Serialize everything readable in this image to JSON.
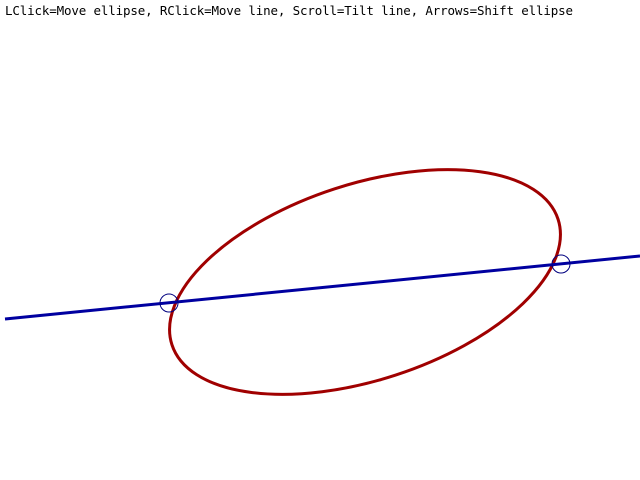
{
  "instructions": "LClick=Move ellipse, RClick=Move line, Scroll=Tilt line, Arrows=Shift ellipse",
  "colors": {
    "background": "#ffffff",
    "text": "#000000",
    "ellipse": "#a00000",
    "line": "#0000a0",
    "intersection_marker": "#000080"
  },
  "scene": {
    "ellipse": {
      "shape": "rotated-ellipse",
      "tilt_deg": -18
    },
    "line": {
      "shape": "straight-line"
    },
    "intersections": [
      {
        "label": "intersection-left"
      },
      {
        "label": "intersection-right"
      }
    ]
  }
}
